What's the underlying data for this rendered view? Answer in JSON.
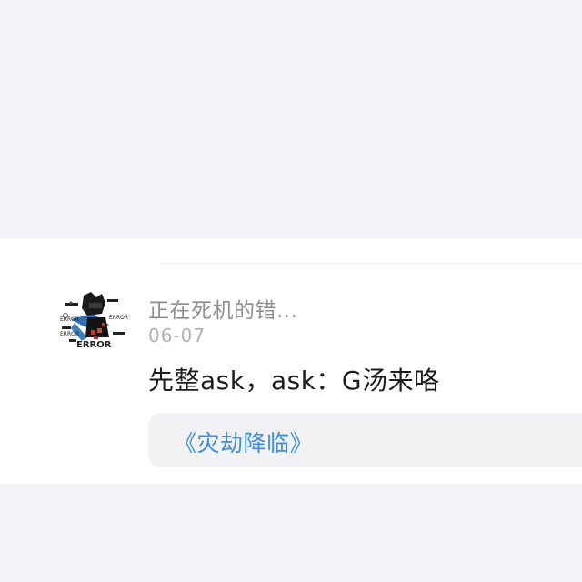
{
  "post": {
    "username": "正在死机的错...",
    "date": "06-07",
    "message": "先整ask，ask：G汤来咯",
    "link_text": "《灾劫降临》",
    "avatar": {
      "icon": "error-character-avatar-icon",
      "error_text": "ERROR"
    }
  },
  "colors": {
    "background": "#f2f2f7",
    "card": "#ffffff",
    "username": "#8e8e93",
    "date": "#b0b0b6",
    "message": "#1c1c1e",
    "link": "#3a8ee6",
    "link_box": "#f2f2f4"
  }
}
